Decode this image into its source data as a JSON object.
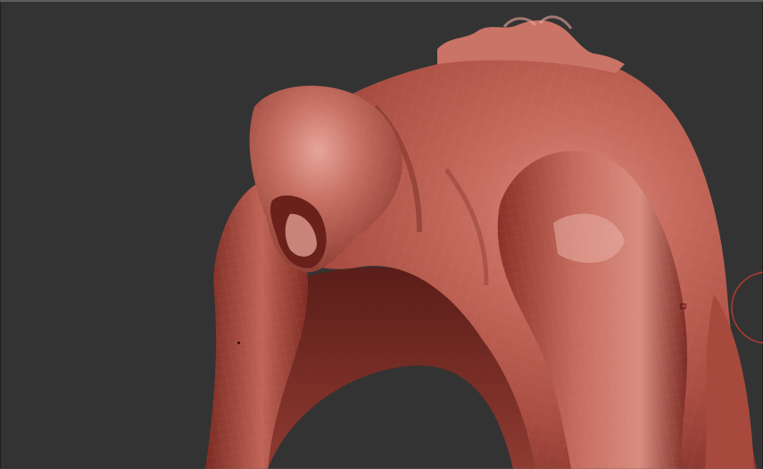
{
  "app": {
    "name": "",
    "canvas_background": "#333333"
  },
  "viewport": {
    "subject": "clay-sculpt-mesh",
    "material_color": "#b9574a",
    "highlight_color": "#e3a197",
    "shadow_color": "#5a1c17",
    "wireframe_color": "#d37b6e"
  },
  "ui": {
    "brush_cursor": {
      "shape": "circle-icon",
      "color": "#b13a34"
    }
  }
}
